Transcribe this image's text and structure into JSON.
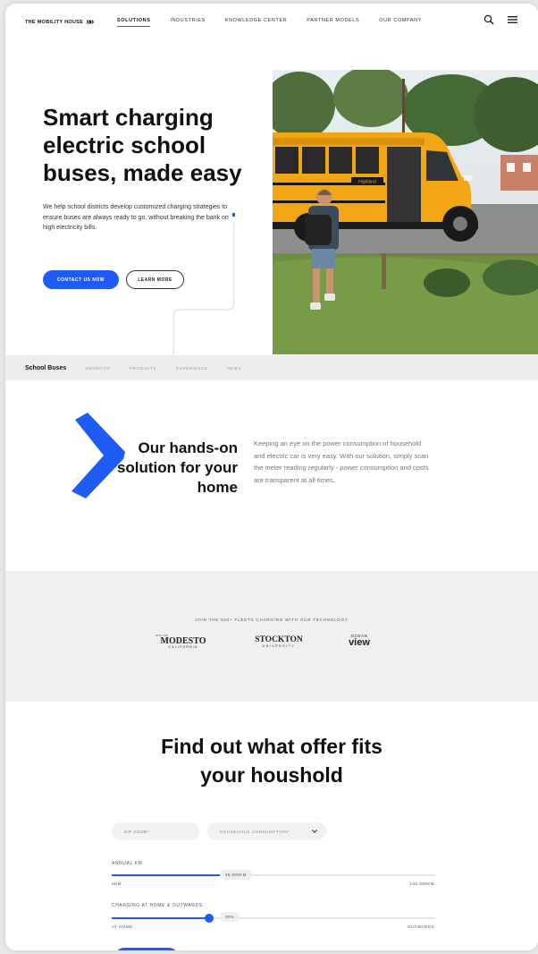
{
  "brand": {
    "name": "THE MOBILITY HOUSE",
    "mark": "»»"
  },
  "nav": {
    "items": [
      {
        "label": "SOLUTIONS",
        "active": true
      },
      {
        "label": "INDUSTRIES",
        "active": false
      },
      {
        "label": "KNOWLEDGE CENTER",
        "active": false
      },
      {
        "label": "PARTNER MODELS",
        "active": false
      },
      {
        "label": "OUR COMPANY",
        "active": false
      }
    ],
    "icons": [
      "search-icon",
      "menu-icon"
    ]
  },
  "hero": {
    "title": "Smart charging electric school buses, made easy",
    "description": "We help school districts develop customized charging strategies to ensure buses are always ready to go, without breaking the bank on high electricity bills.",
    "primary_button": "CONTACT US NOW",
    "secondary_button": "LEARN MORE",
    "bus_sign": "Highland"
  },
  "subnav": {
    "title": "School Buses",
    "items": [
      "BENEFITS",
      "PRODUCTS",
      "EXPERIENCE",
      "NEWS"
    ]
  },
  "feature": {
    "title": "Our hands-on solution for your home",
    "description": "Keeping an eye on the power consumption of household and electric car is very easy. With our solution, simply scan the meter reading regularly - power consumption and costs are transparent at all times."
  },
  "clients": {
    "title": "JOIN THE 500+ FLEETS CHARGING WITH OUR TECHNOLOGY",
    "logos": [
      {
        "small": "CITY OF",
        "name": "MODESTO",
        "sub": "CALIFORNIA"
      },
      {
        "name": "STOCKTON",
        "sub": "UNIVERSITY"
      },
      {
        "small": "OCEAN",
        "name": "view"
      }
    ]
  },
  "offer": {
    "title": "Find out what offer fits your houshold",
    "zip_placeholder": "ZIP CODE*",
    "consumption_placeholder": "HOUSEHOLD CONSUMPTION*",
    "annual": {
      "label": "ANNUAL KM",
      "value": "35.000KM",
      "min": "0KM",
      "max": "100.000KM",
      "fraction": 0.35
    },
    "charging": {
      "label": "CHARGING AT HOME & OUTWARDS",
      "value": "30%",
      "min": "AT HOME",
      "max": "OUTWARDS",
      "fraction": 0.3
    }
  },
  "colors": {
    "accent": "#1f5bf5",
    "bus": "#f2a613",
    "band": "#f0f0f0"
  }
}
